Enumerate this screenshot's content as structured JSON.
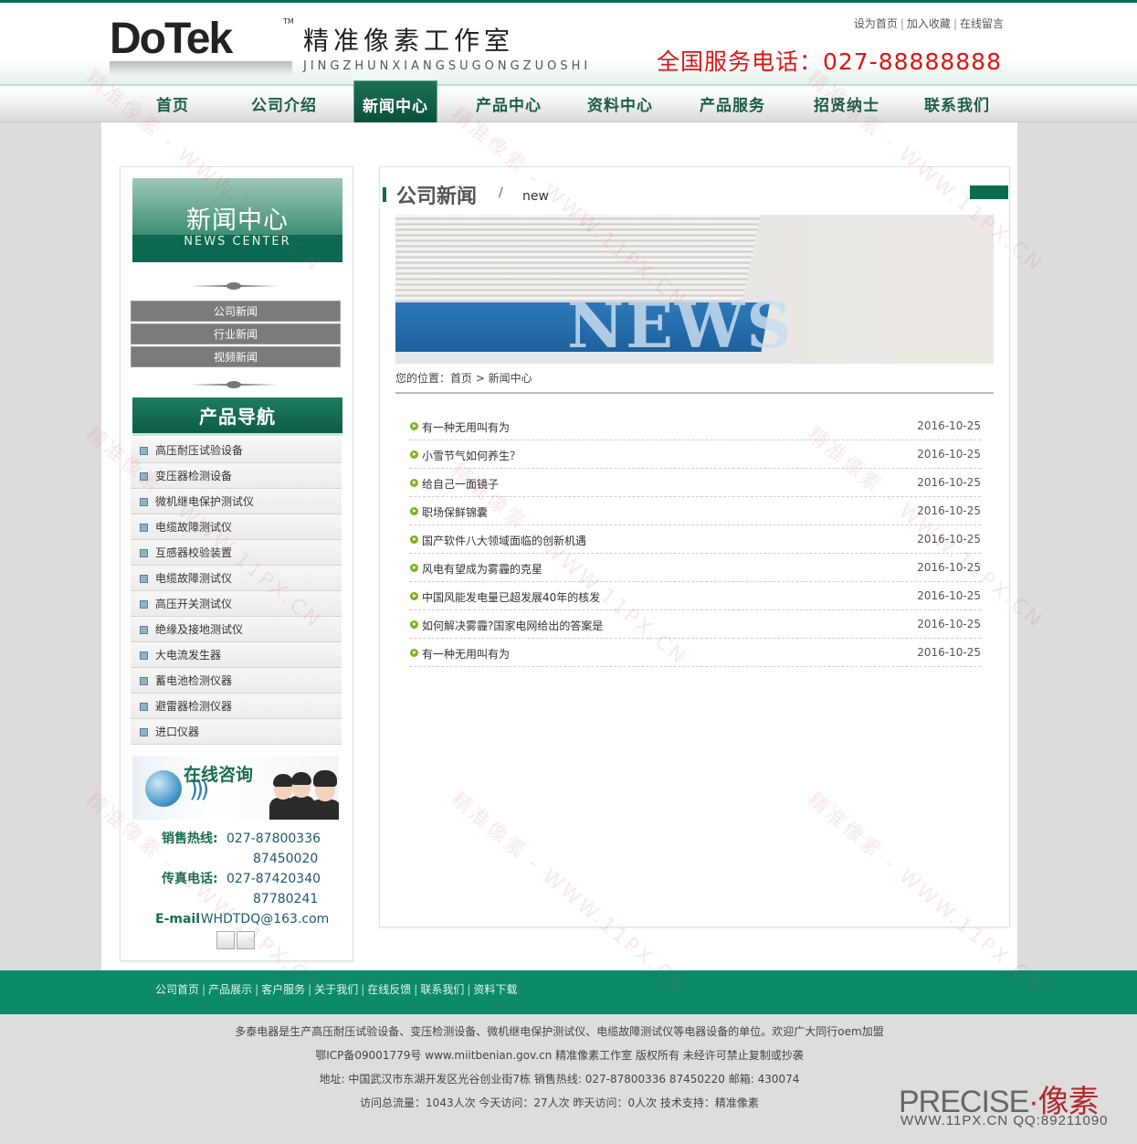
{
  "header": {
    "logo_mark": "DoTek",
    "logo_tm": "TM",
    "logo_cn": "精准像素工作室",
    "logo_pinyin": "JINGZHUNXIANGSUGONGZUOSHI",
    "toplinks": [
      "设为首页",
      "加入收藏",
      "在线留言"
    ],
    "phone": "全国服务电话：027-88888888"
  },
  "nav": {
    "items": [
      "首页",
      "公司介绍",
      "新闻中心",
      "产品中心",
      "资料中心",
      "产品服务",
      "招贤纳士",
      "联系我们"
    ],
    "active": "新闻中心"
  },
  "left": {
    "banner_cn": "新闻中心",
    "banner_en": "NEWS CENTER",
    "subnav": [
      "公司新闻",
      "行业新闻",
      "视频新闻"
    ],
    "prodnav_title": "产品导航",
    "products": [
      "高压耐压试验设备",
      "变压器检测设备",
      "微机继电保护测试仪",
      "电缆故障测试仪",
      "互感器校验装置",
      "电缆故障测试仪",
      "高压开关测试仪",
      "绝缘及接地测试仪",
      "大电流发生器",
      "蓄电池检测仪器",
      "避雷器检测仪器",
      "进口仪器"
    ],
    "consult_title": "在线咨询",
    "contact": {
      "sales_label": "销售热线:",
      "sales_1": "027-87800336",
      "sales_2": "87450020",
      "fax_label": "传真电话:",
      "fax_1": "027-87420340",
      "fax_2": "87780241",
      "email_label": "E-mail",
      "email": ":WHDTDQ@163.com"
    }
  },
  "right": {
    "title_cn": "公司新闻",
    "title_slash": "/",
    "title_en": "new",
    "banner_word": "NEWS",
    "breadcrumb": "您的位置：首页 > 新闻中心",
    "news": [
      {
        "title": "有一种无用叫有为",
        "date": "2016-10-25"
      },
      {
        "title": "小雪节气如何养生？",
        "date": "2016-10-25"
      },
      {
        "title": "给自己一面镜子",
        "date": "2016-10-25"
      },
      {
        "title": "职场保鲜锦囊",
        "date": "2016-10-25"
      },
      {
        "title": "国产软件八大领域面临的创新机遇",
        "date": "2016-10-25"
      },
      {
        "title": "风电有望成为雾霾的克星",
        "date": "2016-10-25"
      },
      {
        "title": "中国风能发电量已超发展40年的核发",
        "date": "2016-10-25"
      },
      {
        "title": "如何解决雾霾?国家电网给出的答案是",
        "date": "2016-10-25"
      },
      {
        "title": "有一种无用叫有为",
        "date": "2016-10-25"
      }
    ]
  },
  "footer": {
    "links": [
      "公司首页",
      "产品展示",
      "客户服务",
      "关于我们",
      "在线反馈",
      "联系我们",
      "资料下载"
    ],
    "line1": "多泰电器是生产高压耐压试验设备、变压检测设备、微机继电保护测试仪、电缆故障测试仪等电器设备的单位。欢迎广大同行oem加盟",
    "line2": "鄂ICP备09001779号 www.miitbenian.gov.cn 精准像素工作室   版权所有 未经许可禁止复制或抄袭",
    "line3": "地址:  中国武汉市东湖开发区光谷创业街7栋    销售热线:  027-87800336 87450220    邮箱:  430074",
    "line4": "访问总流量：1043人次 今天访问：27人次 昨天访问：0人次 技术支持：精准像素"
  },
  "stamp": {
    "brand": "PRECISE",
    "brand_cn": "·像素",
    "line": "WWW.11PX.CN   QQ:89211090"
  },
  "watermark": "精准像素 - WWW.11PX.CN",
  "colors": {
    "brand_green": "#0c6a4e",
    "footer_green": "#0c8a6a",
    "phone_red": "#e01414"
  }
}
